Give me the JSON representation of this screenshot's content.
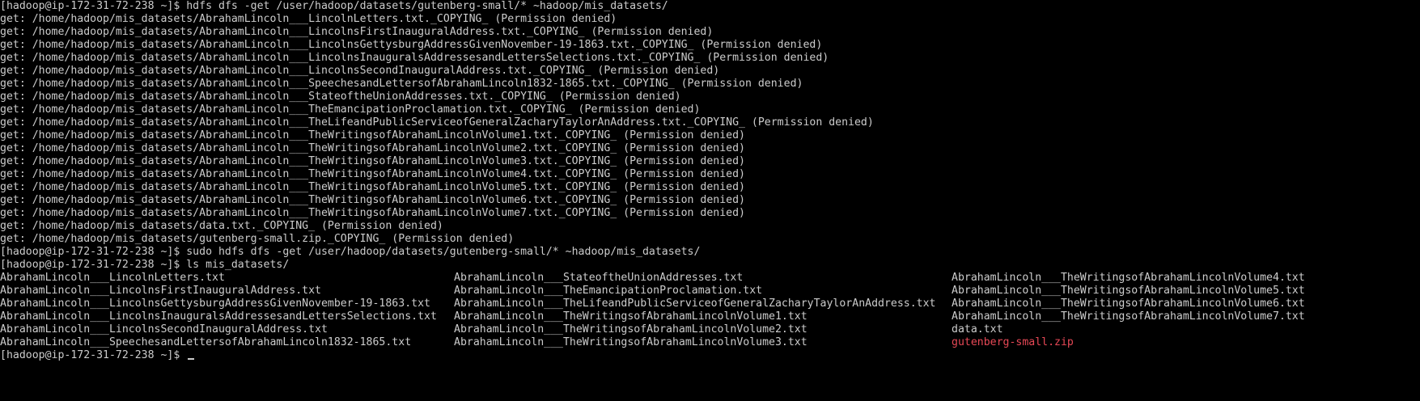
{
  "terminal": {
    "lines": [
      "[hadoop@ip-172-31-72-238 ~]$ hdfs dfs -get /user/hadoop/datasets/gutenberg-small/* ~hadoop/mis_datasets/",
      "get: /home/hadoop/mis_datasets/AbrahamLincoln___LincolnLetters.txt._COPYING_ (Permission denied)",
      "get: /home/hadoop/mis_datasets/AbrahamLincoln___LincolnsFirstInauguralAddress.txt._COPYING_ (Permission denied)",
      "get: /home/hadoop/mis_datasets/AbrahamLincoln___LincolnsGettysburgAddressGivenNovember-19-1863.txt._COPYING_ (Permission denied)",
      "get: /home/hadoop/mis_datasets/AbrahamLincoln___LincolnsInauguralsAddressesandLettersSelections.txt._COPYING_ (Permission denied)",
      "get: /home/hadoop/mis_datasets/AbrahamLincoln___LincolnsSecondInauguralAddress.txt._COPYING_ (Permission denied)",
      "get: /home/hadoop/mis_datasets/AbrahamLincoln___SpeechesandLettersofAbrahamLincoln1832-1865.txt._COPYING_ (Permission denied)",
      "get: /home/hadoop/mis_datasets/AbrahamLincoln___StateoftheUnionAddresses.txt._COPYING_ (Permission denied)",
      "get: /home/hadoop/mis_datasets/AbrahamLincoln___TheEmancipationProclamation.txt._COPYING_ (Permission denied)",
      "get: /home/hadoop/mis_datasets/AbrahamLincoln___TheLifeandPublicServiceofGeneralZacharyTaylorAnAddress.txt._COPYING_ (Permission denied)",
      "get: /home/hadoop/mis_datasets/AbrahamLincoln___TheWritingsofAbrahamLincolnVolume1.txt._COPYING_ (Permission denied)",
      "get: /home/hadoop/mis_datasets/AbrahamLincoln___TheWritingsofAbrahamLincolnVolume2.txt._COPYING_ (Permission denied)",
      "get: /home/hadoop/mis_datasets/AbrahamLincoln___TheWritingsofAbrahamLincolnVolume3.txt._COPYING_ (Permission denied)",
      "get: /home/hadoop/mis_datasets/AbrahamLincoln___TheWritingsofAbrahamLincolnVolume4.txt._COPYING_ (Permission denied)",
      "get: /home/hadoop/mis_datasets/AbrahamLincoln___TheWritingsofAbrahamLincolnVolume5.txt._COPYING_ (Permission denied)",
      "get: /home/hadoop/mis_datasets/AbrahamLincoln___TheWritingsofAbrahamLincolnVolume6.txt._COPYING_ (Permission denied)",
      "get: /home/hadoop/mis_datasets/AbrahamLincoln___TheWritingsofAbrahamLincolnVolume7.txt._COPYING_ (Permission denied)",
      "get: /home/hadoop/mis_datasets/data.txt._COPYING_ (Permission denied)",
      "get: /home/hadoop/mis_datasets/gutenberg-small.zip._COPYING_ (Permission denied)",
      "[hadoop@ip-172-31-72-238 ~]$ sudo hdfs dfs -get /user/hadoop/datasets/gutenberg-small/* ~hadoop/mis_datasets/",
      "[hadoop@ip-172-31-72-238 ~]$ ls mis_datasets/"
    ],
    "ls_rows": [
      [
        "AbrahamLincoln___LincolnLetters.txt",
        "AbrahamLincoln___StateoftheUnionAddresses.txt",
        "AbrahamLincoln___TheWritingsofAbrahamLincolnVolume4.txt"
      ],
      [
        "AbrahamLincoln___LincolnsFirstInauguralAddress.txt",
        "AbrahamLincoln___TheEmancipationProclamation.txt",
        "AbrahamLincoln___TheWritingsofAbrahamLincolnVolume5.txt"
      ],
      [
        "AbrahamLincoln___LincolnsGettysburgAddressGivenNovember-19-1863.txt",
        "AbrahamLincoln___TheLifeandPublicServiceofGeneralZacharyTaylorAnAddress.txt",
        "AbrahamLincoln___TheWritingsofAbrahamLincolnVolume6.txt"
      ],
      [
        "AbrahamLincoln___LincolnsInauguralsAddressesandLettersSelections.txt",
        "AbrahamLincoln___TheWritingsofAbrahamLincolnVolume1.txt",
        "AbrahamLincoln___TheWritingsofAbrahamLincolnVolume7.txt"
      ],
      [
        "AbrahamLincoln___LincolnsSecondInauguralAddress.txt",
        "AbrahamLincoln___TheWritingsofAbrahamLincolnVolume2.txt",
        "data.txt"
      ],
      [
        "AbrahamLincoln___SpeechesandLettersofAbrahamLincoln1832-1865.txt",
        "AbrahamLincoln___TheWritingsofAbrahamLincolnVolume3.txt",
        "gutenberg-small.zip"
      ]
    ],
    "final_prompt": "[hadoop@ip-172-31-72-238 ~]$ ",
    "colors": {
      "background": "#000000",
      "text": "#cccccc",
      "archive_file": "#e74856"
    }
  }
}
